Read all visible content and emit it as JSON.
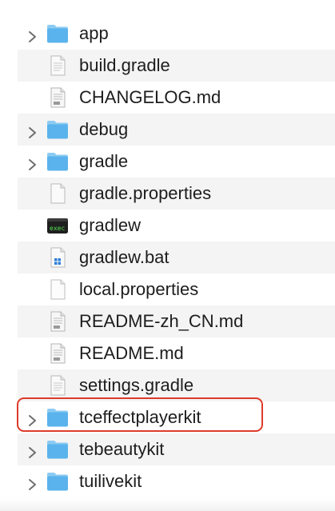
{
  "files": [
    {
      "name": "app",
      "type": "folder",
      "expandable": true
    },
    {
      "name": "build.gradle",
      "type": "gradle",
      "expandable": false
    },
    {
      "name": "CHANGELOG.md",
      "type": "md",
      "expandable": false
    },
    {
      "name": "debug",
      "type": "folder",
      "expandable": true
    },
    {
      "name": "gradle",
      "type": "folder",
      "expandable": true
    },
    {
      "name": "gradle.properties",
      "type": "doc",
      "expandable": false
    },
    {
      "name": "gradlew",
      "type": "exec",
      "expandable": false
    },
    {
      "name": "gradlew.bat",
      "type": "bat",
      "expandable": false
    },
    {
      "name": "local.properties",
      "type": "blank",
      "expandable": false
    },
    {
      "name": "README-zh_CN.md",
      "type": "md",
      "expandable": false
    },
    {
      "name": "README.md",
      "type": "md",
      "expandable": false
    },
    {
      "name": "settings.gradle",
      "type": "gradle",
      "expandable": false
    },
    {
      "name": "tceffectplayerkit",
      "type": "folder",
      "expandable": true,
      "highlighted": true
    },
    {
      "name": "tebeautykit",
      "type": "folder",
      "expandable": true
    },
    {
      "name": "tuilivekit",
      "type": "folder",
      "expandable": true
    }
  ],
  "colors": {
    "folder": "#5ab3ec",
    "folder_tab": "#8ccbf2",
    "highlight": "#dd3b2b",
    "alt_row": "#f4f4f4",
    "text": "#1d1d1f"
  }
}
